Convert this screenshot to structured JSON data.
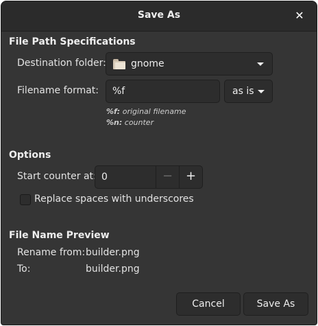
{
  "dialog": {
    "title": "Save As",
    "close_icon": "close-icon"
  },
  "file_path": {
    "section_title": "File Path Specifications",
    "destination_label": "Destination folder:",
    "destination_value": "gnome",
    "destination_icon": "folder-icon",
    "filename_format_label": "Filename format:",
    "filename_format_value": "%f",
    "case_option": "as is",
    "hint_f_key": "%f:",
    "hint_f_desc": "original filename",
    "hint_n_key": "%n:",
    "hint_n_desc": "counter"
  },
  "options": {
    "section_title": "Options",
    "start_counter_label": "Start counter at:",
    "start_counter_value": "0",
    "decrement_label": "−",
    "increment_label": "+",
    "replace_spaces_label": "Replace spaces with underscores",
    "replace_spaces_checked": false
  },
  "preview": {
    "section_title": "File Name Preview",
    "rename_from_label": "Rename from:",
    "rename_from_value": "builder.png",
    "to_label": "To:",
    "to_value": "builder.png"
  },
  "actions": {
    "cancel_label": "Cancel",
    "save_as_label": "Save As"
  }
}
